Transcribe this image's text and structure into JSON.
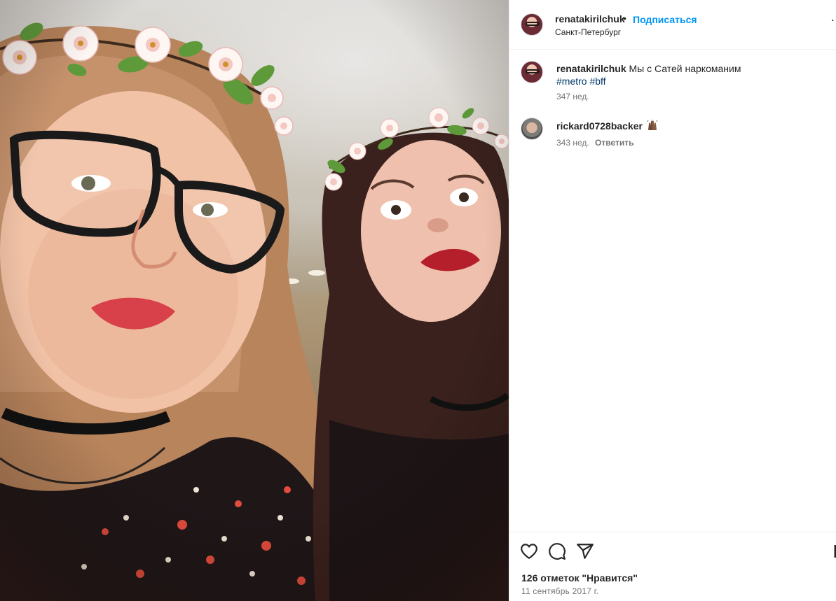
{
  "post": {
    "photo_alt": "",
    "author": {
      "username": "renatakirilchuk",
      "follow_label": "Подписаться",
      "location": "Санкт-Петербург",
      "separator": "•",
      "more_label": "…"
    },
    "caption": {
      "username": "renatakirilchuk",
      "text": "Мы с Сатей наркоманим",
      "hashtags": [
        "#metro",
        "#bff"
      ],
      "time": "347 нед."
    },
    "comments": [
      {
        "username": "rickard0728backer",
        "emoji": "raising-hands-emoji",
        "time": "343 нед.",
        "reply_label": "Ответить"
      }
    ],
    "actions": {
      "like_icon": "heart-icon",
      "comment_icon": "comment-bubble-icon",
      "share_icon": "paper-plane-icon",
      "save_icon": "bookmark-icon"
    },
    "likes_text": "126 отметок \"Нравится\"",
    "date": "11 сентябрь 2017 г."
  },
  "colors": {
    "link_blue": "#0095f6",
    "hashtag_blue": "#00376b",
    "muted": "#737373",
    "text": "#262626",
    "divider": "#efefef"
  }
}
